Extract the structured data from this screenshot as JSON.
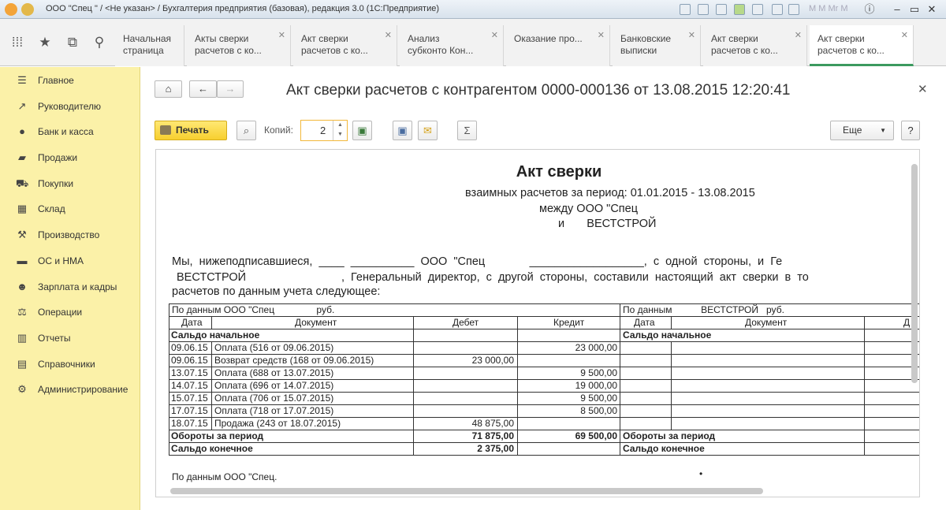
{
  "window": {
    "title": "ООО \"Спец        \" / <Не указан> / Бухгалтерия предприятия (базовая), редакция 3.0  (1С:Предприятие)",
    "blurred_user": "M  M  Mr  M"
  },
  "tabs": [
    {
      "label": "Начальная\nстраница",
      "closable": false
    },
    {
      "label": "Акты сверки\nрасчетов с ко...",
      "closable": true
    },
    {
      "label": "Акт сверки\nрасчетов с ко...",
      "closable": true
    },
    {
      "label": "Анализ\nсубконто Кон...",
      "closable": true
    },
    {
      "label": "Оказание про...",
      "closable": true
    },
    {
      "label": "Банковские\nвыписки",
      "closable": true
    },
    {
      "label": "Акт сверки\nрасчетов с ко...",
      "closable": true
    },
    {
      "label": "Акт сверки\nрасчетов с ко...",
      "closable": true,
      "active": true
    }
  ],
  "sidebar": [
    {
      "label": "Главное",
      "icon": "menu-icon"
    },
    {
      "label": "Руководителю",
      "icon": "chart-icon"
    },
    {
      "label": "Банк и касса",
      "icon": "coin-icon"
    },
    {
      "label": "Продажи",
      "icon": "bag-icon"
    },
    {
      "label": "Покупки",
      "icon": "cart-icon"
    },
    {
      "label": "Склад",
      "icon": "grid-icon"
    },
    {
      "label": "Производство",
      "icon": "factory-icon"
    },
    {
      "label": "ОС и НМА",
      "icon": "truck-icon"
    },
    {
      "label": "Зарплата и кадры",
      "icon": "people-icon"
    },
    {
      "label": "Операции",
      "icon": "scales-icon"
    },
    {
      "label": "Отчеты",
      "icon": "bar-chart-icon"
    },
    {
      "label": "Справочники",
      "icon": "book-icon"
    },
    {
      "label": "Администрирование",
      "icon": "gear-icon"
    }
  ],
  "document": {
    "title": "Акт сверки расчетов с контрагентом 0000-000136 от 13.08.2015 12:20:41",
    "print_label": "Печать",
    "copies_label": "Копий:",
    "copies_value": "2",
    "more_label": "Еще",
    "help_label": "?"
  },
  "report": {
    "title": "Акт сверки",
    "line1": "взаимных расчетов за период: 01.01.2015 - 13.08.2015",
    "line2": "между ООО \"Спец",
    "line3": "и       ВЕСТСТРОЙ",
    "para1a": "Мы,  нижеподписавшиеся,  ____  __________  ООО  \"Спец              __________________,  с  одной  стороны,  и  Ге",
    "para1b": "ВЕСТСТРОЙ                              ,  Генеральный  директор,  с  другой  стороны,  составили  настоящий  акт  сверки  в  то",
    "para1c": "расчетов по данным учета следующее:",
    "left_header": "По данным ООО \"Спец                руб.",
    "right_header": "По данным           ВЕСТСТРОЙ   руб.",
    "cols_left": [
      "Дата",
      "Документ",
      "Дебет",
      "Кредит"
    ],
    "cols_right": [
      "Дата",
      "Документ",
      "Д"
    ],
    "opening_label": "Сальдо начальное",
    "rows": [
      {
        "date": "09.06.15",
        "doc": "Оплата (516 от 09.06.2015)",
        "debit": "",
        "credit": "23 000,00"
      },
      {
        "date": "09.06.15",
        "doc": "Возврат средств (168 от 09.06.2015)",
        "debit": "23 000,00",
        "credit": ""
      },
      {
        "date": "13.07.15",
        "doc": "Оплата (688 от 13.07.2015)",
        "debit": "",
        "credit": "9 500,00"
      },
      {
        "date": "14.07.15",
        "doc": "Оплата (696 от 14.07.2015)",
        "debit": "",
        "credit": "19 000,00"
      },
      {
        "date": "15.07.15",
        "doc": "Оплата (706 от 15.07.2015)",
        "debit": "",
        "credit": "9 500,00"
      },
      {
        "date": "17.07.15",
        "doc": "Оплата (718 от 17.07.2015)",
        "debit": "",
        "credit": "8 500,00"
      },
      {
        "date": "18.07.15",
        "doc": "Продажа (243 от 18.07.2015)",
        "debit": "48 875,00",
        "credit": ""
      }
    ],
    "turnover_label": "Обороты за период",
    "turnover_debit": "71 875,00",
    "turnover_credit": "69 500,00",
    "closing_label": "Сальдо конечное",
    "closing_debit": "2 375,00",
    "footer": "По данным ООО \"Спец."
  }
}
